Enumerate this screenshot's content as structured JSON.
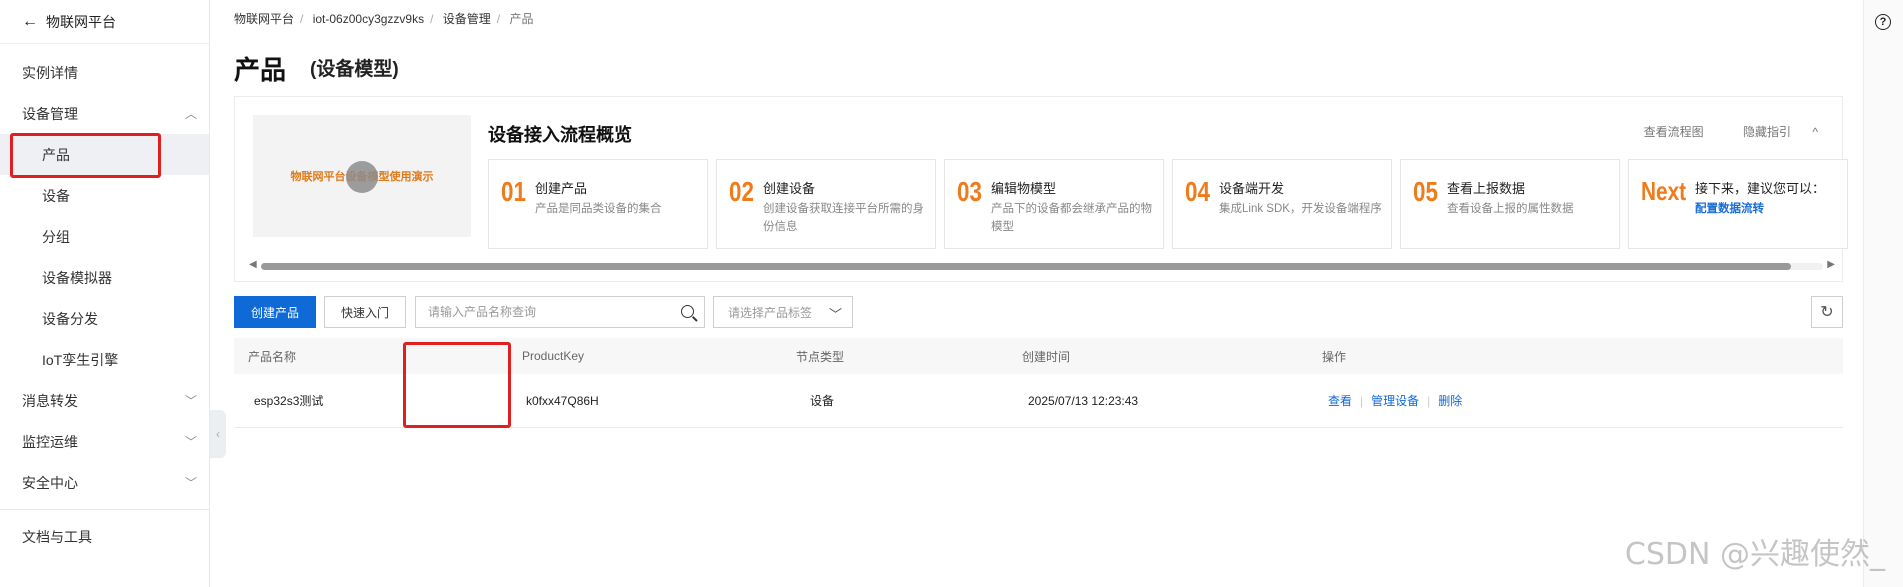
{
  "sidebar": {
    "back_label": "物联网平台",
    "items": [
      {
        "label": "实例详情"
      },
      {
        "label": "设备管理"
      },
      {
        "label": "产品"
      },
      {
        "label": "设备"
      },
      {
        "label": "分组"
      },
      {
        "label": "设备模拟器"
      },
      {
        "label": "设备分发"
      },
      {
        "label": "IoT孪生引擎"
      },
      {
        "label": "消息转发"
      },
      {
        "label": "监控运维"
      },
      {
        "label": "安全中心"
      },
      {
        "label": "文档与工具"
      }
    ]
  },
  "breadcrumb": [
    "物联网平台",
    "iot-06z00cy3gzzv9ks",
    "设备管理",
    "产品"
  ],
  "page": {
    "title": "产品",
    "subtitle": "(设备模型)"
  },
  "guide": {
    "video_text": "物联网平台设备模型使用演示",
    "title": "设备接入流程概览",
    "link_flow": "查看流程图",
    "link_hide": "隐藏指引",
    "steps": [
      {
        "num": "01",
        "title": "创建产品",
        "desc": "产品是同品类设备的集合"
      },
      {
        "num": "02",
        "title": "创建设备",
        "desc": "创建设备获取连接平台所需的身份信息"
      },
      {
        "num": "03",
        "title": "编辑物模型",
        "desc": "产品下的设备都会继承产品的物模型"
      },
      {
        "num": "04",
        "title": "设备端开发",
        "desc": "集成Link SDK，开发设备端程序"
      },
      {
        "num": "05",
        "title": "查看上报数据",
        "desc": "查看设备上报的属性数据"
      },
      {
        "num": "Next",
        "title": "接下来，建议您可以：",
        "desc": "配置数据流转"
      }
    ]
  },
  "toolbar": {
    "create_label": "创建产品",
    "quick_label": "快速入门",
    "search_placeholder": "请输入产品名称查询",
    "tag_placeholder": "请选择产品标签"
  },
  "table": {
    "headers": [
      "产品名称",
      "ProductKey",
      "节点类型",
      "创建时间",
      "操作"
    ],
    "rows": [
      {
        "name": "esp32s3测试",
        "key": "k0fxx47Q86H",
        "node": "设备",
        "created": "2025/07/13 12:23:43"
      }
    ],
    "actions": [
      "查看",
      "管理设备",
      "删除"
    ]
  },
  "watermark": "CSDN @兴趣使然_",
  "colors": {
    "accent": "#0f6ad8",
    "step_number": "#f07b1a",
    "highlight": "#e02020"
  }
}
